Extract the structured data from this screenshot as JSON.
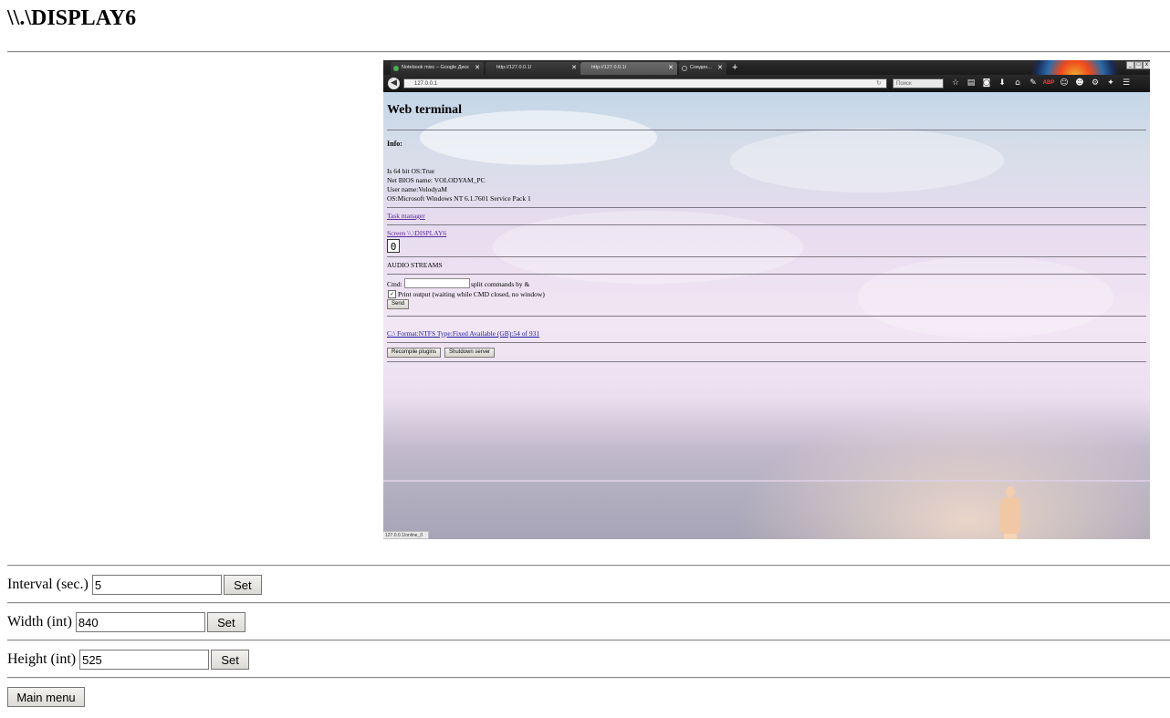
{
  "page": {
    "title": "\\\\.\\DISPLAY6"
  },
  "browser": {
    "tabs": [
      {
        "label": "Notebook misc – Google Диск",
        "icon": "google-drive-icon"
      },
      {
        "label": "http://127.0.0.1/"
      },
      {
        "label": "http://127.0.0.1/",
        "active": true
      },
      {
        "label": "Соедин...",
        "icon": "loading-spinner-icon"
      }
    ],
    "new_tab": "+",
    "url": "127.0.0.1",
    "search_placeholder": "Поиск",
    "adblock_label": "ABP",
    "status_bar": "127.0.0.1/online_0"
  },
  "web_terminal": {
    "title": "Web terminal",
    "info_label": "Info:",
    "info_lines": [
      "Is 64 bit OS:True",
      "Net BIOS name: VOLODYAM_PC",
      "User name:VolodyaM",
      "OS:Microsoft Windows NT 6.1.7601 Service Pack 1"
    ],
    "task_manager_link": "Task manager",
    "screen_link": "Screen \\\\.\\DISPLAY6",
    "screen_zero": "0",
    "audio_streams": "AUDIO STREAMS",
    "cmd_label": "Cmd:",
    "cmd_hint": "split commands by &",
    "print_output_label": "Print output (waiting while CMD closed, no window)",
    "send_button": "Send",
    "drive_link": "C:\\ Format:NTFS Type:Fixed Available (GB):54 of 931",
    "recompile_button": "Recompile plugins",
    "shutdown_button": "Shutdown server"
  },
  "settings": {
    "interval_label": "Interval (sec.)",
    "interval_value": "5",
    "width_label": "Width (int)",
    "width_value": "840",
    "height_label": "Height (int)",
    "height_value": "525",
    "set_label": "Set"
  },
  "main_menu_label": "Main menu"
}
